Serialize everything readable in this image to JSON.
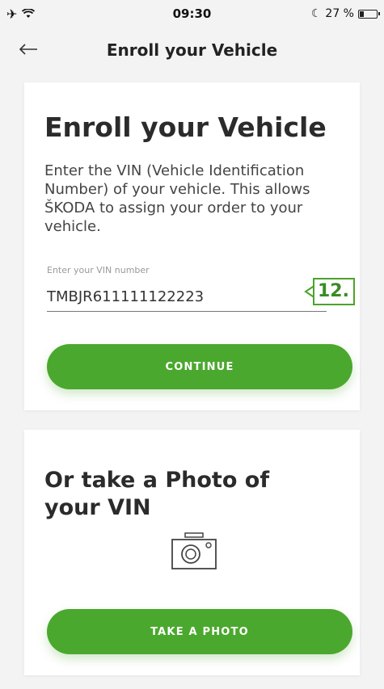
{
  "status": {
    "time": "09:30",
    "battery": "27 %",
    "battery_level": 0.27
  },
  "nav": {
    "title": "Enroll your Vehicle"
  },
  "enroll": {
    "title": "Enroll your Vehicle",
    "description": "Enter the VIN (Vehicle Identification Number) of your vehicle. This allows ŠKODA to assign your order to your vehicle.",
    "field_label": "Enter your VIN number",
    "vin_value": "TMBJR611111122223",
    "badge": "12.",
    "continue_label": "CONTINUE"
  },
  "photo": {
    "title": "Or take a Photo of your VIN",
    "take_photo_label": "TAKE A PHOTO"
  },
  "colors": {
    "accent_green": "#4ba82e",
    "badge_green": "#3a8c24"
  }
}
